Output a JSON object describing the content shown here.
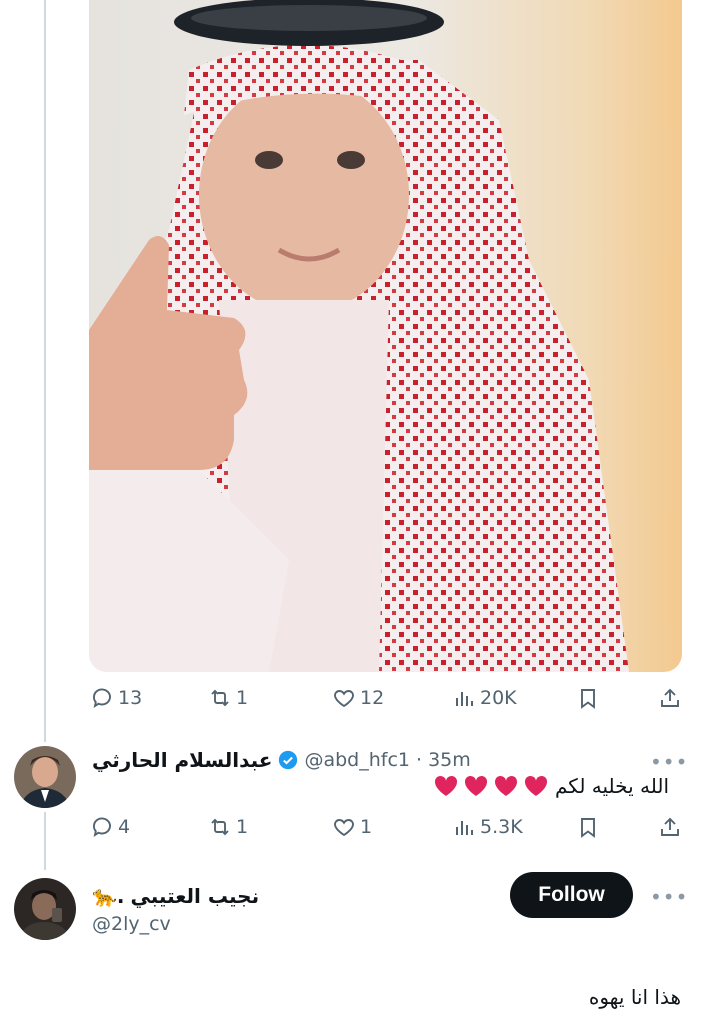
{
  "post": {
    "stats": {
      "replies": "13",
      "reposts": "1",
      "likes": "12",
      "views": "20K"
    }
  },
  "reply": {
    "display_name": "عبدالسلام الحارثي",
    "handle": "@abd_hfc1",
    "time": "· 35m",
    "text": "الله يخليه لكم",
    "hearts": [
      "❤️",
      "❤️",
      "❤️",
      "❤️"
    ],
    "stats": {
      "replies": "4",
      "reposts": "1",
      "likes": "1",
      "views": "5.3K"
    },
    "more": "•••"
  },
  "next_post": {
    "display_name": "نجيب العتيبي",
    "name_emoji": "🐆.",
    "handle": "@2ly_cv",
    "follow_label": "Follow",
    "more": "•••",
    "text": "هذا انا يهوه"
  },
  "colors": {
    "text_primary": "#0f1419",
    "text_secondary": "#536471",
    "verified": "#1d9bf0",
    "heart": "#e0245e",
    "follow_bg": "#0f1419"
  }
}
